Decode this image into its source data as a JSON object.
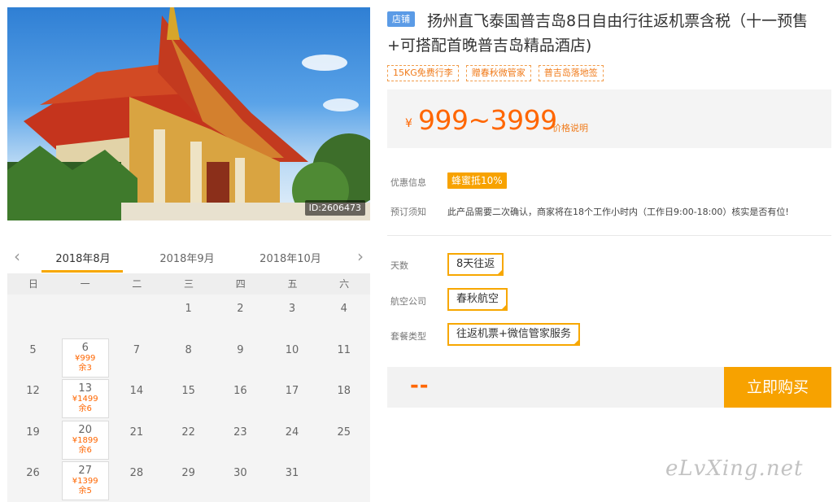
{
  "photo": {
    "id_label": "ID:2606473"
  },
  "calendar": {
    "months": [
      "2018年8月",
      "2018年9月",
      "2018年10月"
    ],
    "weekdays": [
      "日",
      "一",
      "二",
      "三",
      "四",
      "五",
      "六"
    ],
    "days": [
      {
        "d": "1"
      },
      {
        "d": "2"
      },
      {
        "d": "3"
      },
      {
        "d": "4"
      },
      {
        "d": "5"
      },
      {
        "d": "6",
        "price": "¥999",
        "remain": "余3"
      },
      {
        "d": "7"
      },
      {
        "d": "8"
      },
      {
        "d": "9"
      },
      {
        "d": "10"
      },
      {
        "d": "11"
      },
      {
        "d": "12"
      },
      {
        "d": "13",
        "price": "¥1499",
        "remain": "余6"
      },
      {
        "d": "14"
      },
      {
        "d": "15"
      },
      {
        "d": "16"
      },
      {
        "d": "17"
      },
      {
        "d": "18"
      },
      {
        "d": "19"
      },
      {
        "d": "20",
        "price": "¥1899",
        "remain": "余6"
      },
      {
        "d": "21"
      },
      {
        "d": "22"
      },
      {
        "d": "23"
      },
      {
        "d": "24"
      },
      {
        "d": "25"
      },
      {
        "d": "26"
      },
      {
        "d": "27",
        "price": "¥1399",
        "remain": "余5"
      },
      {
        "d": "28"
      },
      {
        "d": "29"
      },
      {
        "d": "30"
      },
      {
        "d": "31"
      }
    ],
    "first_weekday": 3
  },
  "product": {
    "shop_badge": "店铺",
    "title": "扬州直飞泰国普吉岛8日自由行往返机票含税（十一预售+可搭配首晚普吉岛精品酒店)",
    "tags": [
      "15KG免费行李",
      "赠春秋微管家",
      "普吉岛落地签"
    ],
    "price_symbol": "¥",
    "price": "999~3999",
    "price_note": "价格说明",
    "promo_label": "优惠信息",
    "promo_badge": "蜂蜜抵10%",
    "notice_label": "预订须知",
    "notice_text": "此产品需要二次确认，商家将在18个工作小时内（工作日9:00-18:00）核实是否有位!",
    "options": [
      {
        "label": "天数",
        "value": "8天往返"
      },
      {
        "label": "航空公司",
        "value": "春秋航空"
      },
      {
        "label": "套餐类型",
        "value": "往返机票+微信管家服务"
      }
    ],
    "qty_placeholder": "--",
    "buy_label": "立即购买"
  },
  "watermark": "eLvXing.net",
  "colors": {
    "accent": "#f7a200",
    "price": "#ff6600",
    "badge_blue": "#5b9be6"
  }
}
